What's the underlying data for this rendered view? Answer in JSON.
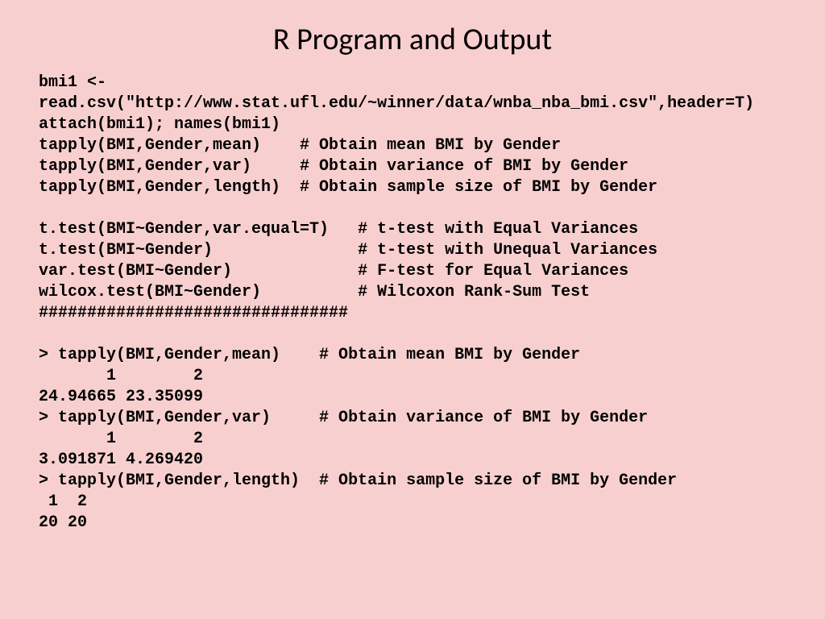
{
  "title": "R Program and Output",
  "code": "bmi1 <-\nread.csv(\"http://www.stat.ufl.edu/~winner/data/wnba_nba_bmi.csv\",header=T)\nattach(bmi1); names(bmi1)\ntapply(BMI,Gender,mean)    # Obtain mean BMI by Gender\ntapply(BMI,Gender,var)     # Obtain variance of BMI by Gender\ntapply(BMI,Gender,length)  # Obtain sample size of BMI by Gender\n\nt.test(BMI~Gender,var.equal=T)   # t-test with Equal Variances\nt.test(BMI~Gender)               # t-test with Unequal Variances\nvar.test(BMI~Gender)             # F-test for Equal Variances\nwilcox.test(BMI~Gender)          # Wilcoxon Rank-Sum Test\n################################\n\n> tapply(BMI,Gender,mean)    # Obtain mean BMI by Gender\n       1        2\n24.94665 23.35099\n> tapply(BMI,Gender,var)     # Obtain variance of BMI by Gender\n       1        2\n3.091871 4.269420\n> tapply(BMI,Gender,length)  # Obtain sample size of BMI by Gender\n 1  2\n20 20"
}
